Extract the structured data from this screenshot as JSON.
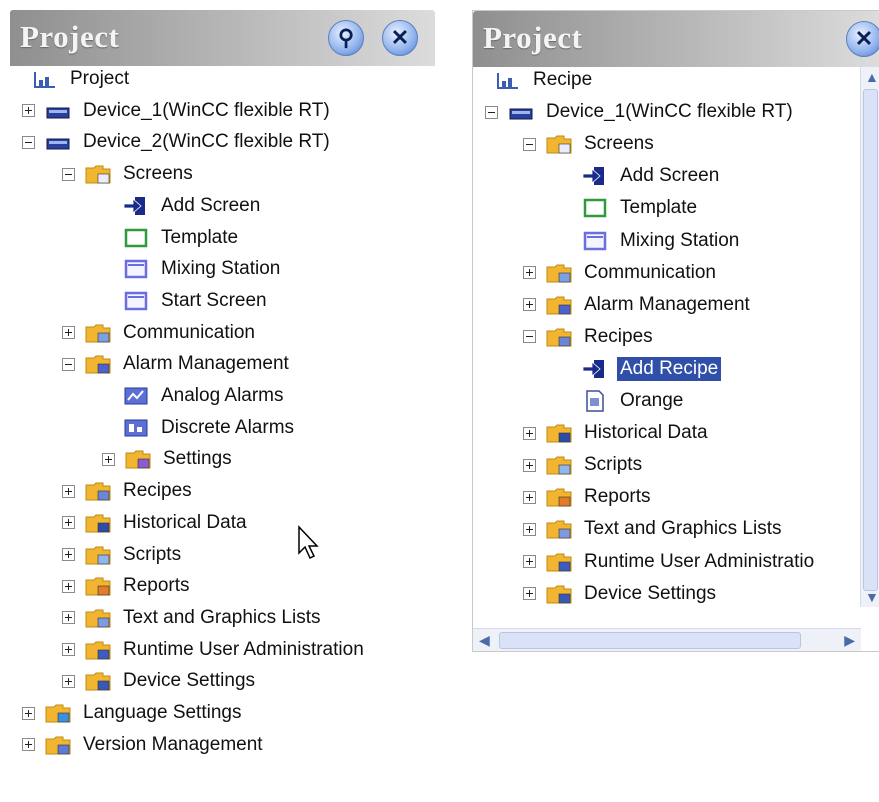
{
  "left_panel": {
    "title": "Project",
    "pin_button": "⚲",
    "close_button": "✕",
    "items": [
      {
        "label": "Project",
        "icon": "project-icon",
        "expander": "none",
        "level": 0
      },
      {
        "label": "Device_1(WinCC flexible RT)",
        "icon": "device-icon",
        "expander": "plus",
        "level": 0
      },
      {
        "label": "Device_2(WinCC flexible RT)",
        "icon": "device-icon",
        "expander": "minus",
        "level": 0
      },
      {
        "label": "Screens",
        "icon": "screens-folder-icon",
        "expander": "minus",
        "level": 1
      },
      {
        "label": "Add Screen",
        "icon": "add-arrow-icon",
        "expander": "none",
        "level": 2
      },
      {
        "label": "Template",
        "icon": "template-icon",
        "expander": "none",
        "level": 2
      },
      {
        "label": "Mixing Station",
        "icon": "screen-icon",
        "expander": "none",
        "level": 2
      },
      {
        "label": "Start Screen",
        "icon": "screen-icon",
        "expander": "none",
        "level": 2
      },
      {
        "label": "Communication",
        "icon": "communication-folder-icon",
        "expander": "plus",
        "level": 1
      },
      {
        "label": "Alarm Management",
        "icon": "alarm-folder-icon",
        "expander": "minus",
        "level": 1
      },
      {
        "label": "Analog Alarms",
        "icon": "analog-alarm-icon",
        "expander": "none",
        "level": 2
      },
      {
        "label": "Discrete Alarms",
        "icon": "discrete-alarm-icon",
        "expander": "none",
        "level": 2
      },
      {
        "label": "Settings",
        "icon": "settings-folder-icon",
        "expander": "plus",
        "level": 2
      },
      {
        "label": "Recipes",
        "icon": "recipes-folder-icon",
        "expander": "plus",
        "level": 1
      },
      {
        "label": "Historical Data",
        "icon": "historical-data-folder-icon",
        "expander": "plus",
        "level": 1
      },
      {
        "label": "Scripts",
        "icon": "scripts-folder-icon",
        "expander": "plus",
        "level": 1
      },
      {
        "label": "Reports",
        "icon": "reports-folder-icon",
        "expander": "plus",
        "level": 1
      },
      {
        "label": "Text and Graphics Lists",
        "icon": "text-graphics-folder-icon",
        "expander": "plus",
        "level": 1
      },
      {
        "label": "Runtime User Administration",
        "icon": "user-admin-folder-icon",
        "expander": "plus",
        "level": 1
      },
      {
        "label": "Device Settings",
        "icon": "device-settings-folder-icon",
        "expander": "plus",
        "level": 1
      },
      {
        "label": "Language Settings",
        "icon": "language-folder-icon",
        "expander": "plus",
        "level": 0
      },
      {
        "label": "Version Management",
        "icon": "version-folder-icon",
        "expander": "plus",
        "level": 0
      }
    ]
  },
  "right_panel": {
    "title": "Project",
    "close_button": "✕",
    "items": [
      {
        "label": "Recipe",
        "icon": "project-icon",
        "expander": "none",
        "level": 0
      },
      {
        "label": "Device_1(WinCC flexible RT)",
        "icon": "device-icon",
        "expander": "minus",
        "level": 0
      },
      {
        "label": "Screens",
        "icon": "screens-folder-icon",
        "expander": "minus",
        "level": 1
      },
      {
        "label": "Add Screen",
        "icon": "add-arrow-icon",
        "expander": "none",
        "level": 2
      },
      {
        "label": "Template",
        "icon": "template-icon",
        "expander": "none",
        "level": 2
      },
      {
        "label": "Mixing Station",
        "icon": "screen-icon",
        "expander": "none",
        "level": 2
      },
      {
        "label": "Communication",
        "icon": "communication-folder-icon",
        "expander": "plus",
        "level": 1
      },
      {
        "label": "Alarm Management",
        "icon": "alarm-folder-icon",
        "expander": "plus",
        "level": 1
      },
      {
        "label": "Recipes",
        "icon": "recipes-folder-icon",
        "expander": "minus",
        "level": 1
      },
      {
        "label": "Add Recipe",
        "icon": "add-arrow-icon",
        "expander": "none",
        "level": 2,
        "selected": true
      },
      {
        "label": "Orange",
        "icon": "recipe-doc-icon",
        "expander": "none",
        "level": 2
      },
      {
        "label": "Historical Data",
        "icon": "historical-data-folder-icon",
        "expander": "plus",
        "level": 1
      },
      {
        "label": "Scripts",
        "icon": "scripts-folder-icon",
        "expander": "plus",
        "level": 1
      },
      {
        "label": "Reports",
        "icon": "reports-folder-icon",
        "expander": "plus",
        "level": 1
      },
      {
        "label": "Text and Graphics Lists",
        "icon": "text-graphics-folder-icon",
        "expander": "plus",
        "level": 1
      },
      {
        "label": "Runtime User Administratio",
        "icon": "user-admin-folder-icon",
        "expander": "plus",
        "level": 1
      },
      {
        "label": "Device Settings",
        "icon": "device-settings-folder-icon",
        "expander": "plus",
        "level": 1
      }
    ]
  },
  "colors": {
    "selection": "#2f4fa8",
    "folder": "#f2b531",
    "screen": "#6a6ee0",
    "titlebar_text": "#f4f4f4"
  }
}
